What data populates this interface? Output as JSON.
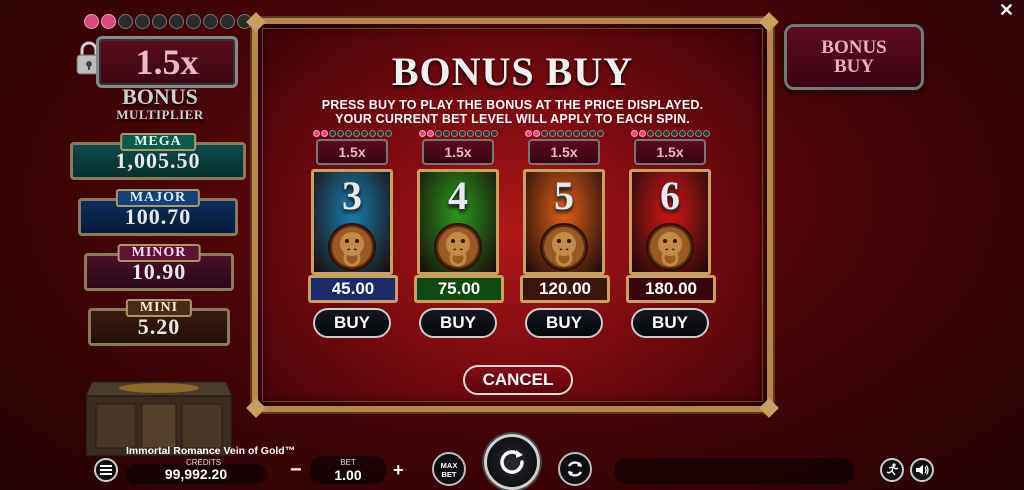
{
  "close_glyph": "✕",
  "left_panel": {
    "multiplier": "1.5x",
    "bonus_title": "BONUS",
    "bonus_subtitle": "MULTIPLIER",
    "gems_filled": 2,
    "gems_total": 10,
    "jackpots": [
      {
        "label": "MEGA",
        "value": "1,005.50",
        "color": "#0e4a4a"
      },
      {
        "label": "MAJOR",
        "value": "100.70",
        "color": "#0b2d5c"
      },
      {
        "label": "MINOR",
        "value": "10.90",
        "color": "#4a1028"
      },
      {
        "label": "MINI",
        "value": "5.20",
        "color": "#3a1a10"
      }
    ]
  },
  "bonus_buy_badge": {
    "line1": "BONUS",
    "line2": "BUY"
  },
  "modal": {
    "title": "BONUS BUY",
    "desc_line1": "PRESS BUY TO PLAY THE BONUS AT THE PRICE DISPLAYED.",
    "desc_line2": "YOUR CURRENT BET LEVEL WILL APPLY TO EACH SPIN.",
    "cards": [
      {
        "multiplier": "1.5x",
        "number": "3",
        "price": "45.00",
        "buy_label": "BUY",
        "art_color": "#1a7fb0",
        "price_bg": "#1a2a6a"
      },
      {
        "multiplier": "1.5x",
        "number": "4",
        "price": "75.00",
        "buy_label": "BUY",
        "art_color": "#2a9a20",
        "price_bg": "#0f4a10"
      },
      {
        "multiplier": "1.5x",
        "number": "5",
        "price": "120.00",
        "buy_label": "BUY",
        "art_color": "#e0601a",
        "price_bg": "#3a1606"
      },
      {
        "multiplier": "1.5x",
        "number": "6",
        "price": "180.00",
        "buy_label": "BUY",
        "art_color": "#d01818",
        "price_bg": "#3a060a"
      }
    ],
    "cancel_label": "CANCEL"
  },
  "bottom_bar": {
    "game_name": "Immortal Romance Vein of Gold™",
    "credits_label": "CREDITS",
    "credits_value": "99,992.20",
    "bet_label": "BET",
    "bet_value": "1.00",
    "minus": "−",
    "plus": "+",
    "maxbet_line1": "MAX",
    "maxbet_line2": "BET"
  }
}
